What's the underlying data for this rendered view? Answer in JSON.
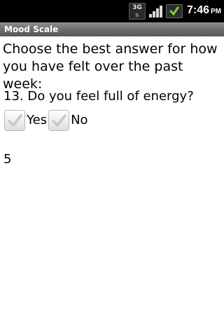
{
  "status_bar": {
    "network": "3G",
    "time": "7:46",
    "ampm": "PM",
    "icons": [
      "3g-icon",
      "signal-icon",
      "battery-icon"
    ]
  },
  "title_bar": {
    "title": "Mood Scale"
  },
  "content": {
    "instructions": "Choose the best answer for how you have felt over the past week:",
    "question": "13. Do you feel full of energy?",
    "options": [
      {
        "label": "Yes",
        "checked": false
      },
      {
        "label": "No",
        "checked": false
      }
    ],
    "value": "5"
  },
  "colors": {
    "status_bar_bg": "#000000",
    "title_bar_bg": "#6a6a6a",
    "background": "#ffffff",
    "text": "#000000"
  }
}
